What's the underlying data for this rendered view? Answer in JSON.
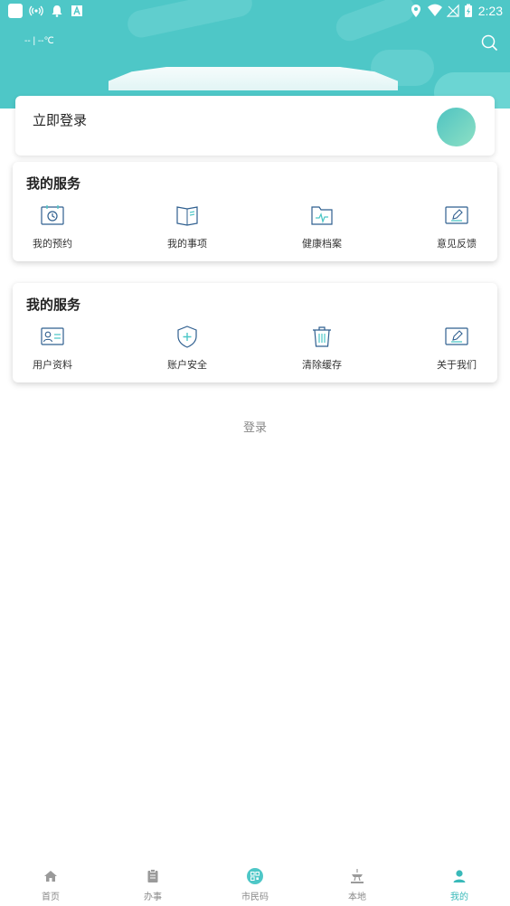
{
  "status_bar": {
    "time": "2:23"
  },
  "header": {
    "weather": "-- | --℃"
  },
  "login_card": {
    "title": "立即登录"
  },
  "services_card": {
    "title": "我的服务",
    "items": [
      {
        "label": "我的预约",
        "icon": "calendar-clock-icon"
      },
      {
        "label": "我的事项",
        "icon": "book-icon"
      },
      {
        "label": "健康档案",
        "icon": "health-folder-icon"
      },
      {
        "label": "意见反馈",
        "icon": "edit-icon"
      }
    ]
  },
  "settings_card": {
    "title": "我的服务",
    "items": [
      {
        "label": "用户资料",
        "icon": "id-card-icon"
      },
      {
        "label": "账户安全",
        "icon": "shield-icon"
      },
      {
        "label": "清除缓存",
        "icon": "trash-icon"
      },
      {
        "label": "关于我们",
        "icon": "edit-icon"
      }
    ]
  },
  "login_link": "登录",
  "bottom_nav": {
    "active": "我的",
    "items": [
      {
        "label": "首页",
        "icon": "home-icon"
      },
      {
        "label": "办事",
        "icon": "clipboard-icon"
      },
      {
        "label": "市民码",
        "icon": "qr-code-icon"
      },
      {
        "label": "本地",
        "icon": "landmark-icon"
      },
      {
        "label": "我的",
        "icon": "user-icon"
      }
    ]
  },
  "colors": {
    "accent": "#4ec7c7",
    "icon_stroke": "#2f5f8f",
    "nav_active": "#39b9b9"
  }
}
